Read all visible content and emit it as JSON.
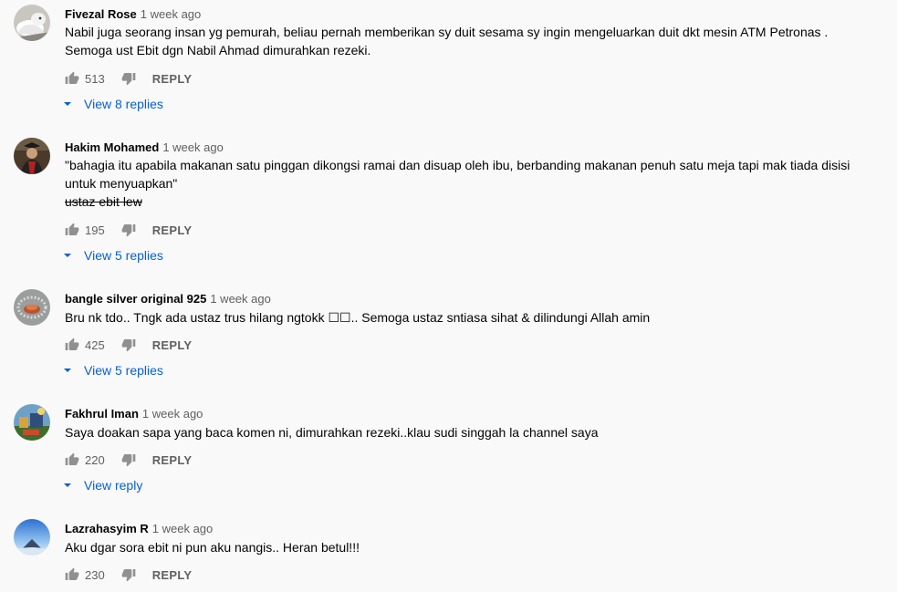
{
  "comments": [
    {
      "author": "Fivezal Rose",
      "time": "1 week ago",
      "lines": [
        "Nabil juga seorang insan yg pemurah, beliau pernah memberikan sy duit sesama sy ingin mengeluarkan duit dkt mesin ATM Petronas .",
        "Semoga ust Ebit dgn Nabil Ahmad dimurahkan rezeki."
      ],
      "likes": "513",
      "reply_label": "REPLY",
      "replies_label": "View 8 replies"
    },
    {
      "author": "Hakim Mohamed",
      "time": "1 week ago",
      "lines": [
        "\"bahagia itu apabila makanan satu pinggan dikongsi ramai dan disuap oleh ibu, berbanding makanan penuh satu meja tapi mak tiada disisi",
        "untuk menyuapkan\""
      ],
      "strike_line": "ustaz ebit lew",
      "likes": "195",
      "reply_label": "REPLY",
      "replies_label": "View 5 replies"
    },
    {
      "author": "bangle silver original 925",
      "time": "1 week ago",
      "lines": [
        "Bru nk tdo.. Tngk ada ustaz trus hilang ngtokk ☐☐.. Semoga ustaz sntiasa sihat & dilindungi Allah amin"
      ],
      "likes": "425",
      "reply_label": "REPLY",
      "replies_label": "View 5 replies"
    },
    {
      "author": "Fakhrul Iman",
      "time": "1 week ago",
      "lines": [
        "Saya doakan sapa yang baca komen ni, dimurahkan rezeki..klau sudi singgah la channel saya"
      ],
      "likes": "220",
      "reply_label": "REPLY",
      "replies_label": "View reply"
    },
    {
      "author": "Lazrahasyim R",
      "time": "1 week ago",
      "lines": [
        "Aku dgar sora ebit ni pun aku nangis.. Heran betul!!!"
      ],
      "likes": "230",
      "reply_label": "REPLY"
    }
  ],
  "colors": {
    "link_blue": "#065fd4",
    "meta_gray": "#606060",
    "background": "#f9f9f9"
  },
  "icons": {
    "like": "thumbs-up-icon",
    "dislike": "thumbs-down-icon",
    "expand": "caret-down-icon"
  }
}
